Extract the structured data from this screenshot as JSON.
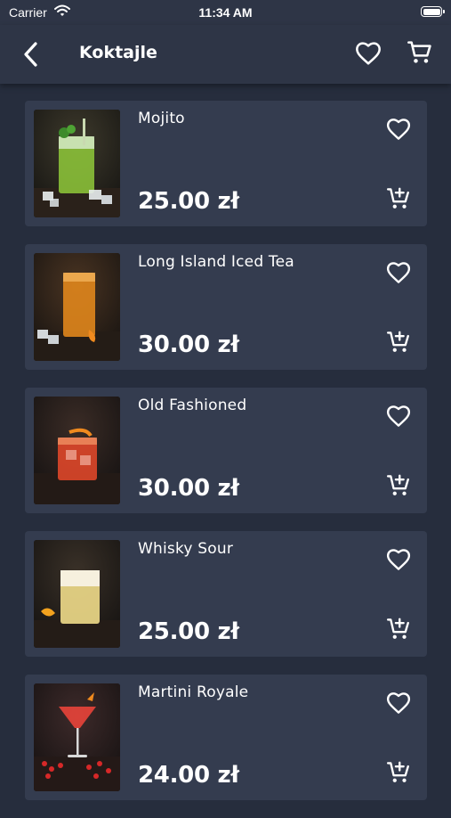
{
  "status_bar": {
    "carrier": "Carrier",
    "time": "11:34 AM",
    "battery_level": 1.0
  },
  "nav": {
    "title": "Koktajle",
    "icons": [
      "back-chevron-icon",
      "heart-icon",
      "cart-icon"
    ]
  },
  "products": [
    {
      "name": "Mojito",
      "price": "25.00 zł",
      "accent": "#9bd22f"
    },
    {
      "name": "Long Island Iced Tea",
      "price": "30.00 zł",
      "accent": "#e0861c"
    },
    {
      "name": "Old Fashioned",
      "price": "30.00 zł",
      "accent": "#e2482a"
    },
    {
      "name": "Whisky Sour",
      "price": "25.00 zł",
      "accent": "#efdb8a"
    },
    {
      "name": "Martini Royale",
      "price": "24.00 zł",
      "accent": "#e9443a"
    }
  ],
  "colors": {
    "background": "#262d3d",
    "header": "#2e3546",
    "card": "#343c4f",
    "text": "#ffffff"
  }
}
